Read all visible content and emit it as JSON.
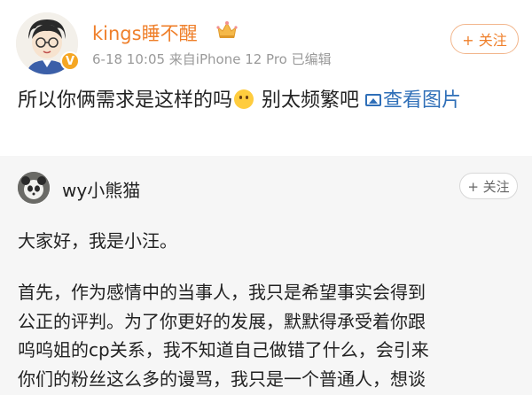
{
  "post": {
    "author_name": "kings睡不醒",
    "verified_badge": "V",
    "meta": "6-18 10:05  来自iPhone 12 Pro  已编辑",
    "follow_label": "+ 关注",
    "text_before": "所以你俩需求是这样的吗",
    "emoji_icon": "thinking-emoji-icon",
    "text_after": " 别太频繁吧 ",
    "image_link_label": "查看图片"
  },
  "repost": {
    "author_name": "wy小熊猫",
    "follow_label": "+ 关注",
    "greeting": "大家好，我是小汪。",
    "paragraph": "首先，作为感情中的当事人，我只是希望事实会得到\n公正的评判。为了你更好的发展，默默得承受着你跟\n呜呜姐的cp关系，我不知道自己做错了什么，会引来\n你们的粉丝这么多的谩骂，我只是一个普通人，想谈"
  },
  "colors": {
    "accent": "#ef7f2a",
    "link": "#2f6fb8",
    "repost_bg": "#f6f6f6"
  }
}
